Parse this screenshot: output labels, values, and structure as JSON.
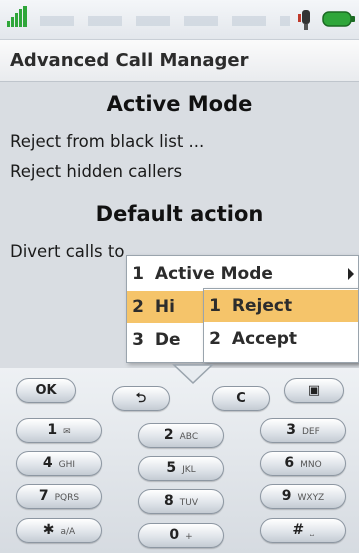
{
  "app": {
    "title": "Advanced Call Manager"
  },
  "content": {
    "section1_title": "Active Mode",
    "items1": [
      "Reject from black list ...",
      "Reject hidden callers"
    ],
    "section2_title": "Default action",
    "items2": [
      "Divert calls to"
    ]
  },
  "menu": {
    "items": [
      {
        "num": "1",
        "label": "Active Mode"
      },
      {
        "num": "2",
        "label": "Hi"
      },
      {
        "num": "3",
        "label": "De"
      }
    ],
    "submenu": [
      {
        "num": "1",
        "label": "Reject"
      },
      {
        "num": "2",
        "label": "Accept"
      }
    ]
  },
  "keypad": {
    "ok": "OK",
    "back": "⮌",
    "clear": "C",
    "menu_icon": "▣",
    "keys": [
      {
        "digit": "1",
        "letters": "✉"
      },
      {
        "digit": "2",
        "letters": "ABC"
      },
      {
        "digit": "3",
        "letters": "DEF"
      },
      {
        "digit": "4",
        "letters": "GHI"
      },
      {
        "digit": "5",
        "letters": "JKL"
      },
      {
        "digit": "6",
        "letters": "MNO"
      },
      {
        "digit": "7",
        "letters": "PQRS"
      },
      {
        "digit": "8",
        "letters": "TUV"
      },
      {
        "digit": "9",
        "letters": "WXYZ"
      },
      {
        "digit": "✱",
        "letters": "a/A"
      },
      {
        "digit": "0",
        "letters": "+"
      },
      {
        "digit": "#",
        "letters": "⎵"
      }
    ]
  },
  "colors": {
    "highlight": "#f5c46a",
    "background": "#d9dde2",
    "battery": "#2fa63a"
  }
}
